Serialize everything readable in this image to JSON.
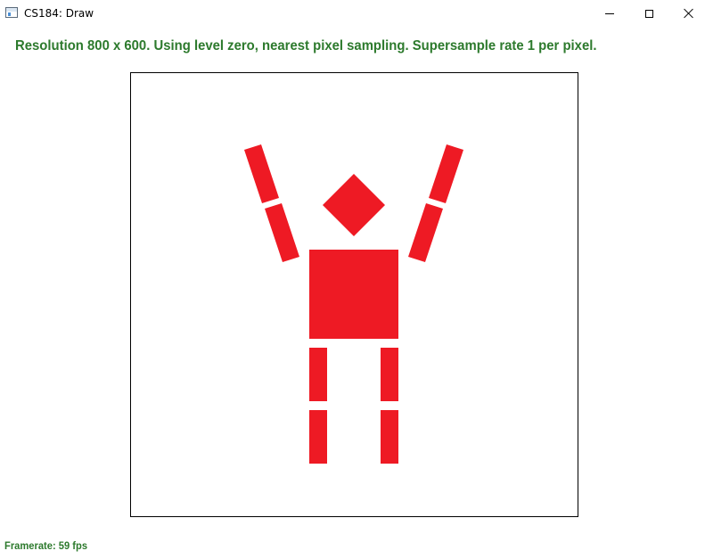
{
  "window": {
    "title": "CS184: Draw",
    "icon": "app-window-icon",
    "controls": [
      "minimize-icon",
      "maximize-icon",
      "close-icon"
    ]
  },
  "status": {
    "text": "Resolution 800 x 600. Using level zero, nearest pixel sampling. Supersample rate 1 per pixel."
  },
  "canvas": {
    "background": "#ffffff",
    "border_color": "#000000",
    "figure_color": "#ee1a24",
    "figure": "stick-figure"
  },
  "footer": {
    "framerate": "Framerate: 59 fps"
  },
  "colors": {
    "status_text": "#2d7a2d"
  }
}
